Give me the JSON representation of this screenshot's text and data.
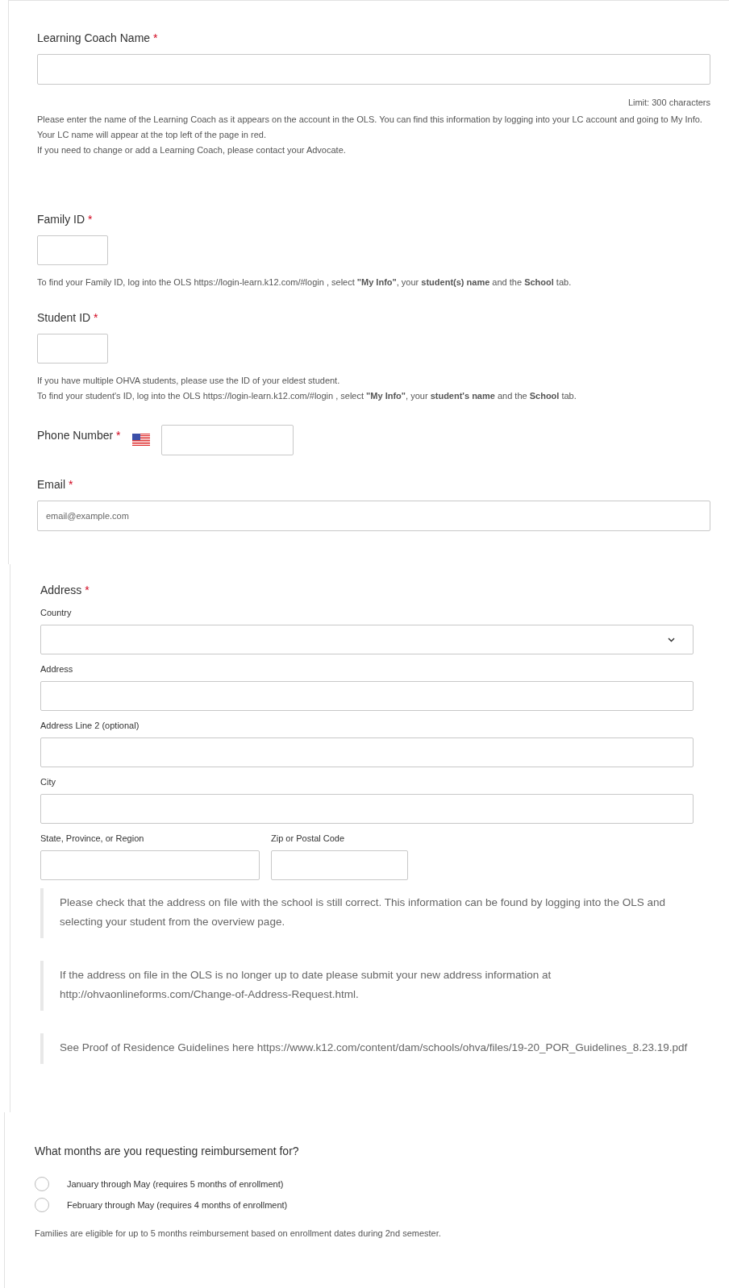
{
  "contact_fields": [
    {
      "kind": "text",
      "label": "Learning Coach Name",
      "required_mark": "*",
      "limit": "Limit: 300 characters",
      "help": [
        "Please enter the name of the Learning Coach as it appears on the account in the OLS.  You can find this information by logging into your LC account and going to My Info.  Your LC name will appear at the top left of the page in red.",
        "If you need to change or add a Learning Coach, please contact your Advocate."
      ]
    },
    {
      "kind": "short",
      "label": "Family ID",
      "required_mark": "*",
      "help": [
        "To find your Family ID, log into the OLS  https://login-learn.k12.com/#login , select **\"My Info\"**, your **student(s) name** and the **School** tab."
      ]
    },
    {
      "kind": "short",
      "label": "Student ID",
      "required_mark": "*",
      "help": [
        "If you have multiple OHVA students, please use the ID of your eldest student.",
        "To find your student's ID, log into the OLS  https://login-learn.k12.com/#login , select **\"My Info\"**, your **student's name** and the **School** tab."
      ]
    },
    {
      "kind": "phone",
      "label": "Phone Number",
      "required_mark": "*"
    },
    {
      "kind": "text",
      "label": "Email",
      "required_mark": "*",
      "placeholder": "email@example.com"
    }
  ],
  "address": {
    "label": "Address",
    "required_mark": "*",
    "fields": [
      {
        "kind": "select",
        "label": "Country"
      },
      {
        "kind": "text",
        "label": "Address"
      },
      {
        "kind": "text",
        "label": "Address Line 2 (optional)"
      },
      {
        "kind": "text",
        "label": "City"
      }
    ],
    "pair": [
      {
        "label": "State, Province, or Region"
      },
      {
        "label": "Zip or Postal Code"
      }
    ],
    "notes": [
      "Please check that the address on file with the school is still correct.  This information can be found by logging into the OLS and selecting your student from the overview page.",
      "If the address on file in the OLS is no longer up to date please submit your new address information at http://ohvaonlineforms.com/Change-of-Address-Request.html.",
      "See Proof of Residence Guidelines here  https://www.k12.com/content/dam/schools/ohva/files/19-20_POR_Guidelines_8.23.19.pdf"
    ]
  },
  "months": {
    "question": "What months are you requesting reimbursement for?",
    "options": [
      {
        "label": "January through May (requires 5 months of enrollment)",
        "selected": false
      },
      {
        "label": "February through May (requires 4 months of enrollment)",
        "selected": false
      }
    ],
    "footer": "Families are eligible for up to 5 months reimbursement based on enrollment dates during 2nd semester."
  }
}
